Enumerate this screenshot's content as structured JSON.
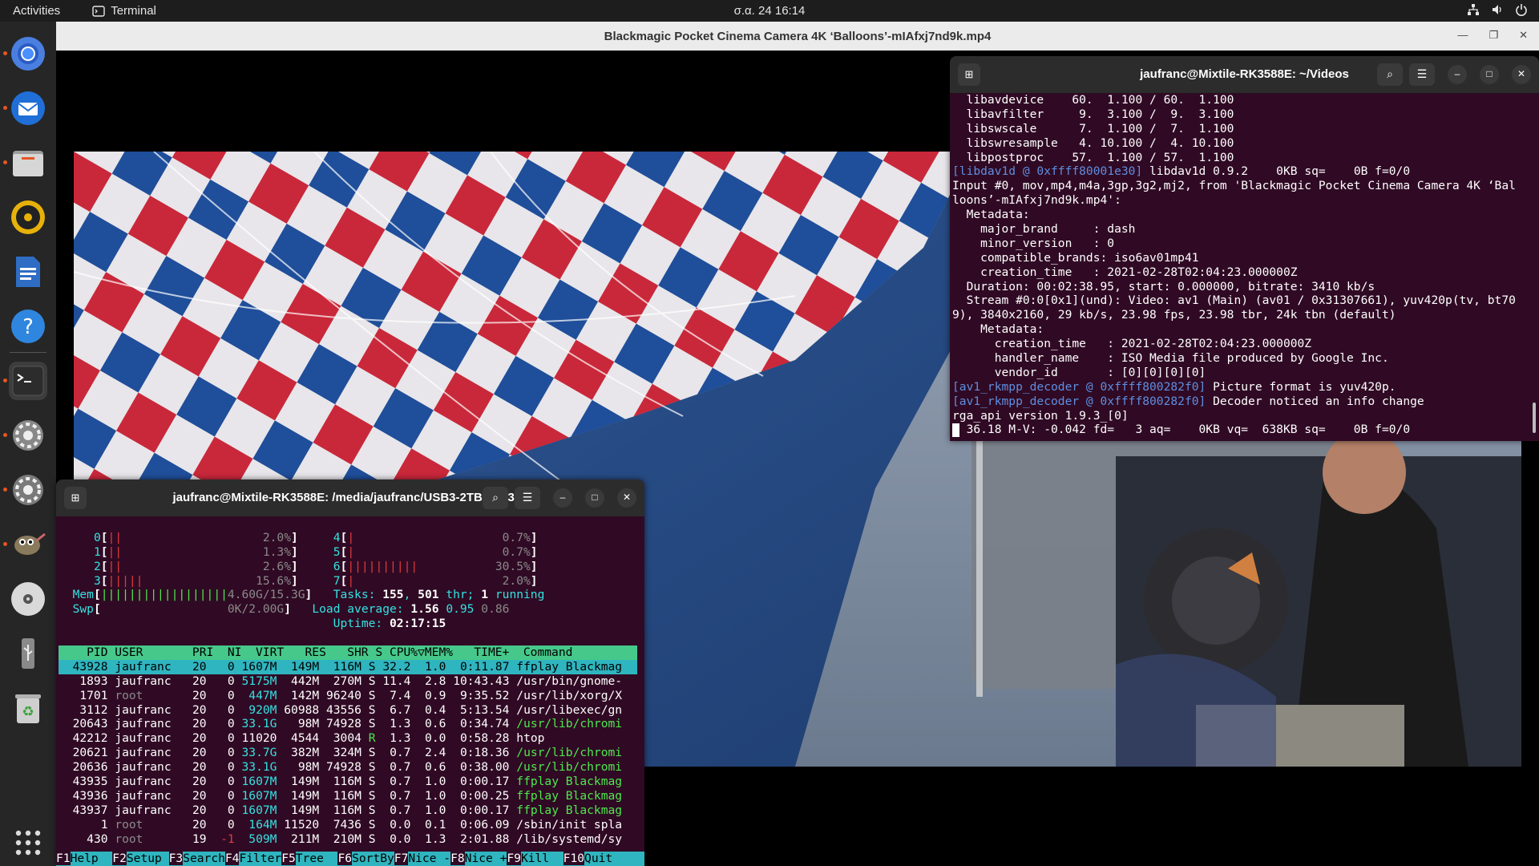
{
  "topbar": {
    "activities": "Activities",
    "app_name": "Terminal",
    "clock": "σ.α. 24 16:14",
    "tray": [
      "network-icon",
      "volume-icon",
      "power-icon"
    ]
  },
  "dock": {
    "apps": [
      {
        "name": "chromium-icon",
        "running": true
      },
      {
        "name": "thunderbird-icon",
        "running": true
      },
      {
        "name": "files-icon",
        "running": true
      },
      {
        "name": "rhythmbox-icon",
        "running": false
      },
      {
        "name": "libreoffice-writer-icon",
        "running": false
      },
      {
        "name": "help-icon",
        "running": false
      },
      {
        "name": "terminal-icon",
        "running": true
      },
      {
        "name": "settings-icon",
        "running": true
      },
      {
        "name": "settings-icon-2",
        "running": true
      },
      {
        "name": "gimp-icon",
        "running": true
      },
      {
        "name": "disc-icon",
        "running": false
      },
      {
        "name": "usb-drive-icon",
        "running": false
      },
      {
        "name": "trash-icon",
        "running": false
      },
      {
        "name": "show-apps-icon",
        "running": false
      }
    ]
  },
  "player": {
    "title": "Blackmagic Pocket Cinema Camera 4K ‘Balloons’-mIAfxj7nd9k.mp4"
  },
  "term_videos": {
    "title": "jaufranc@Mixtile-RK3588E: ~/Videos",
    "lines": [
      {
        "t": "  libavdevice    60.  1.100 / 60.  1.100"
      },
      {
        "t": "  libavfilter     9.  3.100 /  9.  3.100"
      },
      {
        "t": "  libswscale      7.  1.100 /  7.  1.100"
      },
      {
        "t": "  libswresample   4. 10.100 /  4. 10.100"
      },
      {
        "t": "  libpostproc    57.  1.100 / 57.  1.100"
      },
      {
        "p": "[libdav1d @ 0xffff80001e30]",
        "t": " libdav1d 0.9.2    0KB sq=    0B f=0/0"
      },
      {
        "t": "Input #0, mov,mp4,m4a,3gp,3g2,mj2, from 'Blackmagic Pocket Cinema Camera 4K ‘Bal"
      },
      {
        "t": "loons’-mIAfxj7nd9k.mp4':"
      },
      {
        "t": "  Metadata:"
      },
      {
        "t": "    major_brand     : dash"
      },
      {
        "t": "    minor_version   : 0"
      },
      {
        "t": "    compatible_brands: iso6av01mp41"
      },
      {
        "t": "    creation_time   : 2021-02-28T02:04:23.000000Z"
      },
      {
        "t": "  Duration: 00:02:38.95, start: 0.000000, bitrate: 3410 kb/s"
      },
      {
        "t": "  Stream #0:0[0x1](und): Video: av1 (Main) (av01 / 0x31307661), yuv420p(tv, bt70"
      },
      {
        "t": "9), 3840x2160, 29 kb/s, 23.98 fps, 23.98 tbr, 24k tbn (default)"
      },
      {
        "t": "    Metadata:"
      },
      {
        "t": "      creation_time   : 2021-02-28T02:04:23.000000Z"
      },
      {
        "t": "      handler_name    : ISO Media file produced by Google Inc."
      },
      {
        "t": "      vendor_id       : [0][0][0][0]"
      },
      {
        "p": "[av1_rkmpp_decoder @ 0xffff800282f0]",
        "t": " Picture format is yuv420p."
      },
      {
        "p": "[av1_rkmpp_decoder @ 0xffff800282f0]",
        "t": " Decoder noticed an info change"
      },
      {
        "t": "rga_api version 1.9.3_[0]"
      },
      {
        "t": "  36.18 M-V: -0.042 fd=   3 aq=    0KB vq=  638KB sq=    0B f=0/0"
      }
    ]
  },
  "term_htop": {
    "title": "jaufranc@Mixtile-RK3588E: /media/jaufranc/USB3-2TB/FX8350",
    "cpus_left": [
      {
        "id": "0",
        "bars": "||",
        "pct": "2.0%"
      },
      {
        "id": "1",
        "bars": "||",
        "pct": "1.3%"
      },
      {
        "id": "2",
        "bars": "||",
        "pct": "2.6%"
      },
      {
        "id": "3",
        "bars": "|||||",
        "pct": "15.6%"
      }
    ],
    "cpus_right": [
      {
        "id": "4",
        "bars": "|",
        "pct": "0.7%"
      },
      {
        "id": "5",
        "bars": "|",
        "pct": "0.7%"
      },
      {
        "id": "6",
        "bars": "||||||||||",
        "pct": "30.5%"
      },
      {
        "id": "7",
        "bars": "|",
        "pct": "2.0%"
      }
    ],
    "mem": {
      "label": "Mem",
      "bars": "||||||||||||||||||",
      "value": "4.60G/15.3G"
    },
    "swp": {
      "label": "Swp",
      "value": "0K/2.00G"
    },
    "tasks": {
      "label": "Tasks:",
      "count": "155",
      "sep": ",",
      "thr": "501",
      "thr_label": "thr;",
      "running": "1",
      "running_label": "running"
    },
    "load": {
      "label": "Load average:",
      "v1": "1.56",
      "v2": "0.95",
      "v3": "0.86"
    },
    "uptime": {
      "label": "Uptime:",
      "value": "02:17:15"
    },
    "header": "    PID USER       PRI  NI  VIRT   RES   SHR S CPU%▽MEM%   TIME+  Command",
    "rows": [
      {
        "pid": "43928",
        "user": "jaufranc",
        "pri": "20",
        "ni": "0",
        "virt": "1607M",
        "res": "149M",
        "shr": "116M",
        "s": "S",
        "cpu": "32.2",
        "mem": "1.0",
        "time": "0:11.87",
        "cmd": "ffplay Blackmag",
        "sel": true
      },
      {
        "pid": "1893",
        "user": "jaufranc",
        "pri": "20",
        "ni": "0",
        "virt": "5175M",
        "res": "442M",
        "shr": "270M",
        "s": "S",
        "cpu": "11.4",
        "mem": "2.8",
        "time": "10:43.43",
        "cmd": "/usr/bin/gnome-"
      },
      {
        "pid": "1701",
        "user": "root",
        "pri": "20",
        "ni": "0",
        "virt": "447M",
        "res": "142M",
        "shr": "96240",
        "s": "S",
        "cpu": "7.4",
        "mem": "0.9",
        "time": "9:35.52",
        "cmd": "/usr/lib/xorg/X"
      },
      {
        "pid": "3112",
        "user": "jaufranc",
        "pri": "20",
        "ni": "0",
        "virt": "920M",
        "res": "60988",
        "shr": "43556",
        "s": "S",
        "cpu": "6.7",
        "mem": "0.4",
        "time": "5:13.54",
        "cmd": "/usr/libexec/gn"
      },
      {
        "pid": "20643",
        "user": "jaufranc",
        "pri": "20",
        "ni": "0",
        "virt": "33.1G",
        "res": "98M",
        "shr": "74928",
        "s": "S",
        "cpu": "1.3",
        "mem": "0.6",
        "time": "0:34.74",
        "cmd": "/usr/lib/chromi"
      },
      {
        "pid": "42212",
        "user": "jaufranc",
        "pri": "20",
        "ni": "0",
        "virt": "11020",
        "res": "4544",
        "shr": "3004",
        "s": "R",
        "cpu": "1.3",
        "mem": "0.0",
        "time": "0:58.28",
        "cmd": "htop"
      },
      {
        "pid": "20621",
        "user": "jaufranc",
        "pri": "20",
        "ni": "0",
        "virt": "33.7G",
        "res": "382M",
        "shr": "324M",
        "s": "S",
        "cpu": "0.7",
        "mem": "2.4",
        "time": "0:18.36",
        "cmd": "/usr/lib/chromi"
      },
      {
        "pid": "20636",
        "user": "jaufranc",
        "pri": "20",
        "ni": "0",
        "virt": "33.1G",
        "res": "98M",
        "shr": "74928",
        "s": "S",
        "cpu": "0.7",
        "mem": "0.6",
        "time": "0:38.00",
        "cmd": "/usr/lib/chromi"
      },
      {
        "pid": "43935",
        "user": "jaufranc",
        "pri": "20",
        "ni": "0",
        "virt": "1607M",
        "res": "149M",
        "shr": "116M",
        "s": "S",
        "cpu": "0.7",
        "mem": "1.0",
        "time": "0:00.17",
        "cmd": "ffplay Blackmag"
      },
      {
        "pid": "43936",
        "user": "jaufranc",
        "pri": "20",
        "ni": "0",
        "virt": "1607M",
        "res": "149M",
        "shr": "116M",
        "s": "S",
        "cpu": "0.7",
        "mem": "1.0",
        "time": "0:00.25",
        "cmd": "ffplay Blackmag"
      },
      {
        "pid": "43937",
        "user": "jaufranc",
        "pri": "20",
        "ni": "0",
        "virt": "1607M",
        "res": "149M",
        "shr": "116M",
        "s": "S",
        "cpu": "0.7",
        "mem": "1.0",
        "time": "0:00.17",
        "cmd": "ffplay Blackmag"
      },
      {
        "pid": "1",
        "user": "root",
        "pri": "20",
        "ni": "0",
        "virt": "164M",
        "res": "11520",
        "shr": "7436",
        "s": "S",
        "cpu": "0.0",
        "mem": "0.1",
        "time": "0:06.09",
        "cmd": "/sbin/init spla"
      },
      {
        "pid": "430",
        "user": "root",
        "pri": "19",
        "ni": "-1",
        "virt": "509M",
        "res": "211M",
        "shr": "210M",
        "s": "S",
        "cpu": "0.0",
        "mem": "1.3",
        "time": "2:01.88",
        "cmd": "/lib/systemd/sy"
      }
    ],
    "fkeys": [
      {
        "k": "F1",
        "l": "Help  "
      },
      {
        "k": "F2",
        "l": "Setup "
      },
      {
        "k": "F3",
        "l": "Search"
      },
      {
        "k": "F4",
        "l": "Filter"
      },
      {
        "k": "F5",
        "l": "Tree  "
      },
      {
        "k": "F6",
        "l": "SortBy"
      },
      {
        "k": "F7",
        "l": "Nice -"
      },
      {
        "k": "F8",
        "l": "Nice +"
      },
      {
        "k": "F9",
        "l": "Kill  "
      },
      {
        "k": "F10",
        "l": "Quit"
      }
    ]
  }
}
